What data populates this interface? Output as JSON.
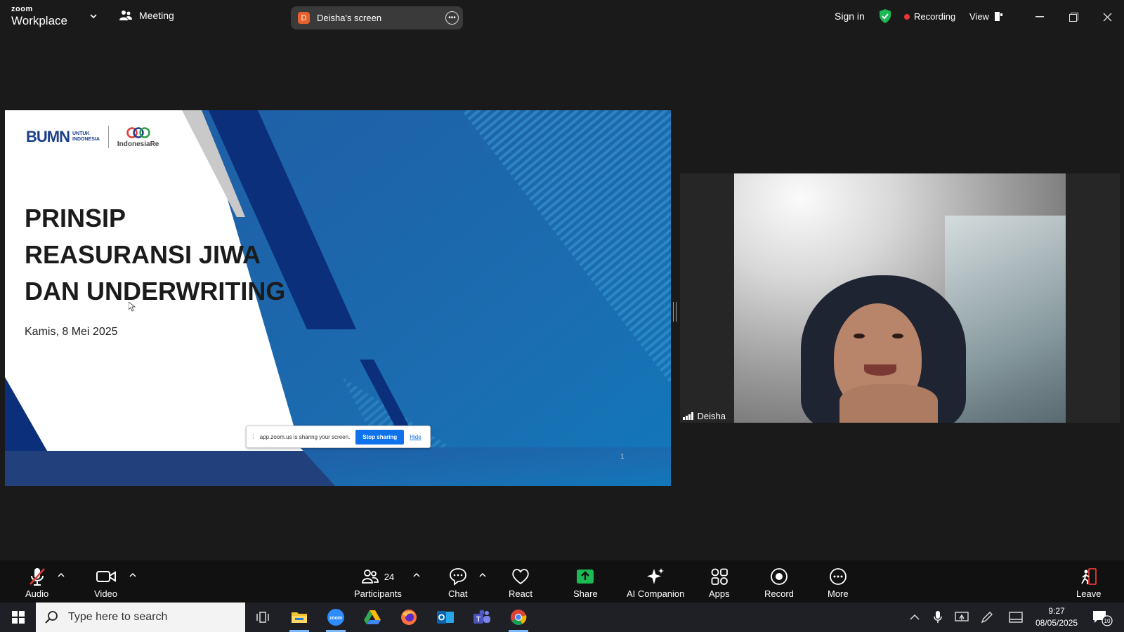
{
  "app": {
    "logo_line1": "zoom",
    "logo_line2": "Workplace",
    "meeting_label": "Meeting",
    "screen_avatar_letter": "D",
    "screen_label": "Deisha's screen",
    "sign_in": "Sign in",
    "recording": "Recording",
    "view": "View"
  },
  "slide": {
    "logo_bumn": "BUMN",
    "logo_bumn_sub": "UNTUK\nINDONESIA",
    "logo_ire": "IndonesiaRe",
    "title": "PRINSIP\nREASURANSI JIWA\nDAN UNDERWRITING",
    "date": "Kamis, 8 Mei 2025",
    "page_number": "1",
    "share_notice": "app.zoom.us is sharing your screen.",
    "stop_sharing": "Stop sharing",
    "hide": "Hide"
  },
  "video": {
    "participant_name": "Deisha"
  },
  "toolbar": {
    "audio": "Audio",
    "video": "Video",
    "participants": "Participants",
    "participants_count": "24",
    "chat": "Chat",
    "react": "React",
    "share": "Share",
    "ai_companion": "AI Companion",
    "apps": "Apps",
    "record": "Record",
    "more": "More",
    "leave": "Leave"
  },
  "taskbar": {
    "search_placeholder": "Type here to search",
    "time": "9:27",
    "date": "08/05/2025",
    "notification_count": "10"
  },
  "colors": {
    "share_green": "#1db954",
    "slide_navy": "#0b2f7a",
    "slide_blue": "#1b6cb0",
    "recording_red": "#e53935",
    "zoom_blue": "#0e72ed"
  }
}
